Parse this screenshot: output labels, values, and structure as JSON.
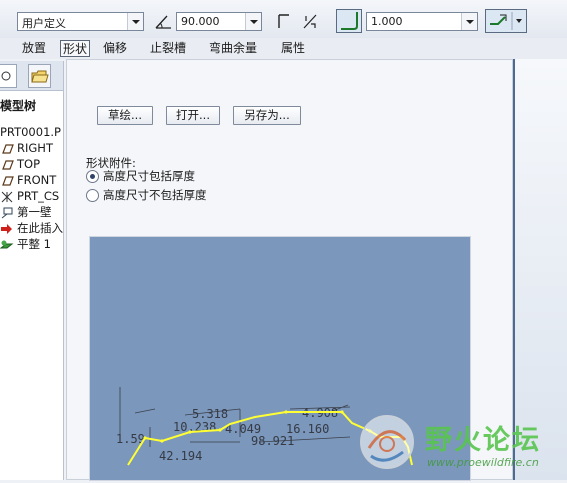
{
  "toolbar": {
    "bend_type_select": "用户定义",
    "angle_value": "90.000",
    "radius_value": "1.000"
  },
  "tabs": [
    {
      "label": "放置",
      "active": false
    },
    {
      "label": "形状",
      "active": true
    },
    {
      "label": "偏移",
      "active": false
    },
    {
      "label": "止裂槽",
      "active": false
    },
    {
      "label": "弯曲余量",
      "active": false
    },
    {
      "label": "属性",
      "active": false
    }
  ],
  "tree": {
    "title": "模型树",
    "items": [
      {
        "label": "PRT0001.P",
        "icon": "part-icon"
      },
      {
        "label": "RIGHT",
        "icon": "datum-plane-icon"
      },
      {
        "label": "TOP",
        "icon": "datum-plane-icon"
      },
      {
        "label": "FRONT",
        "icon": "datum-plane-icon"
      },
      {
        "label": "PRT_CS",
        "icon": "coordinate-system-icon"
      },
      {
        "label": "第一壁",
        "icon": "first-wall-icon"
      },
      {
        "label": "在此插入",
        "icon": "insert-here-arrow-icon"
      },
      {
        "label": "平整 1",
        "icon": "flat-wall-icon"
      }
    ]
  },
  "panel": {
    "buttons": {
      "sketch": "草绘...",
      "open": "打开...",
      "save_as": "另存为..."
    },
    "attach_label": "形状附件:",
    "radio_options": [
      {
        "label": "高度尺寸包括厚度",
        "selected": true
      },
      {
        "label": "高度尺寸不包括厚度",
        "selected": false
      }
    ],
    "preview_dims": [
      "5.318",
      "10.238",
      "4.049",
      "4.908",
      "16.160",
      "98.921",
      "42.194",
      "1.59"
    ]
  },
  "watermark": {
    "name": "野火论坛",
    "url": "www.proewildfire.cn"
  },
  "colors": {
    "preview_bg": "#7b97bb",
    "sketch_line": "#ffff33",
    "toolbar_bg": "#e3e8f0"
  }
}
